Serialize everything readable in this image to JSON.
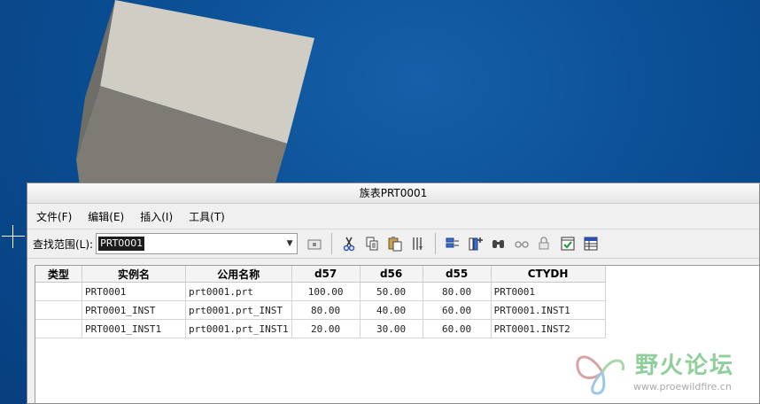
{
  "window": {
    "title": "族表PRT0001"
  },
  "menu": [
    {
      "label": "文件(F)"
    },
    {
      "label": "编辑(E)"
    },
    {
      "label": "插入(I)"
    },
    {
      "label": "工具(T)"
    }
  ],
  "toolbar": {
    "lookup_label": "查找范围(L):",
    "lookup_value": "PRT0001",
    "icons": [
      "open-folder-icon",
      "cut-icon",
      "copy-icon",
      "paste-icon",
      "sort-icon",
      "verify-icon",
      "add-column-icon",
      "find-icon",
      "preview-icon",
      "lock-icon",
      "check-icon",
      "table-icon"
    ]
  },
  "table": {
    "columns": [
      "类型",
      "实例名",
      "公用名称",
      "d57",
      "d56",
      "d55",
      "CTYDH"
    ],
    "rows": [
      [
        "",
        "PRT0001",
        "prt0001.prt",
        "100.00",
        "50.00",
        "80.00",
        "PRT0001"
      ],
      [
        "",
        "PRT0001_INST",
        "prt0001.prt_INST",
        "80.00",
        "40.00",
        "60.00",
        "PRT0001.INST1"
      ],
      [
        "",
        "PRT0001_INST1",
        "prt0001.prt_INST1",
        "20.00",
        "30.00",
        "60.00",
        "PRT0001.INST2"
      ]
    ]
  },
  "watermark": {
    "title": "野火论坛",
    "url": "www.proewildfire.cn"
  },
  "colors": {
    "background": "#0b4f95",
    "block_top": "#cfcdc4",
    "block_side": "#7d7b74",
    "watermark_green": "#8fcf9a"
  }
}
